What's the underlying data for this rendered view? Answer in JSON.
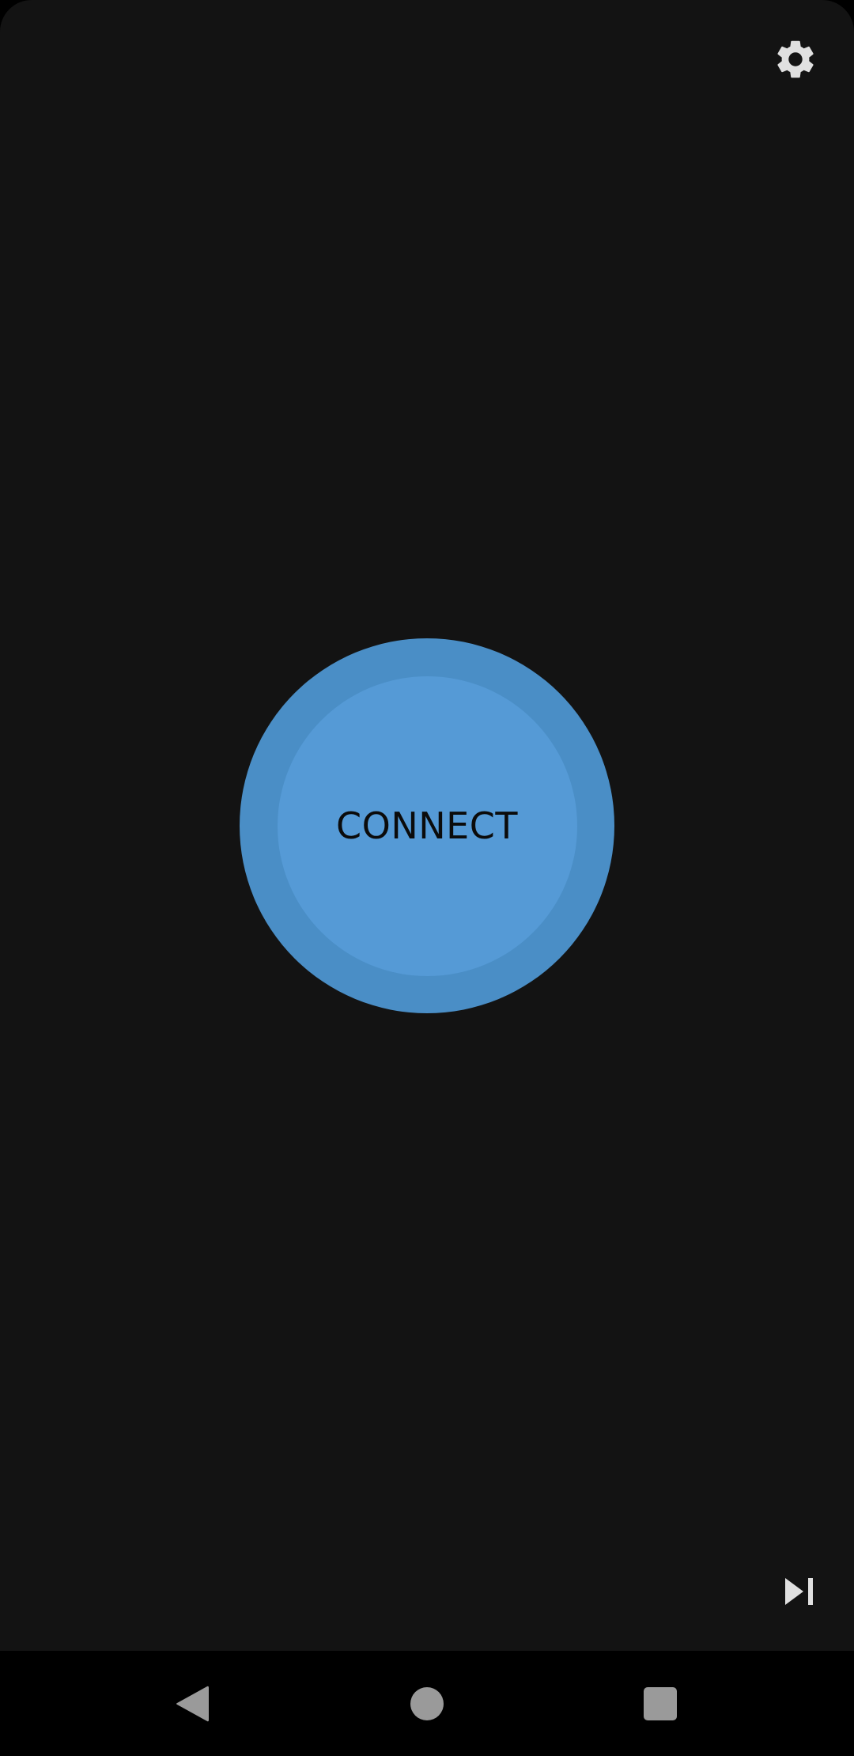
{
  "app": {
    "connect_label": "CONNECT",
    "settings_icon": "gear-icon",
    "skip_icon": "skip-next-icon"
  },
  "colors": {
    "background": "#131313",
    "button_ring": "#4a8ec6",
    "button_fill": "#559ad6",
    "button_text": "#0b0b0b",
    "icon_light": "#e0e0e0",
    "nav_icon": "#9a9a9a",
    "navbar": "#000000"
  },
  "navbar": {
    "back_icon": "back-triangle-icon",
    "home_icon": "home-circle-icon",
    "recents_icon": "recents-square-icon"
  }
}
